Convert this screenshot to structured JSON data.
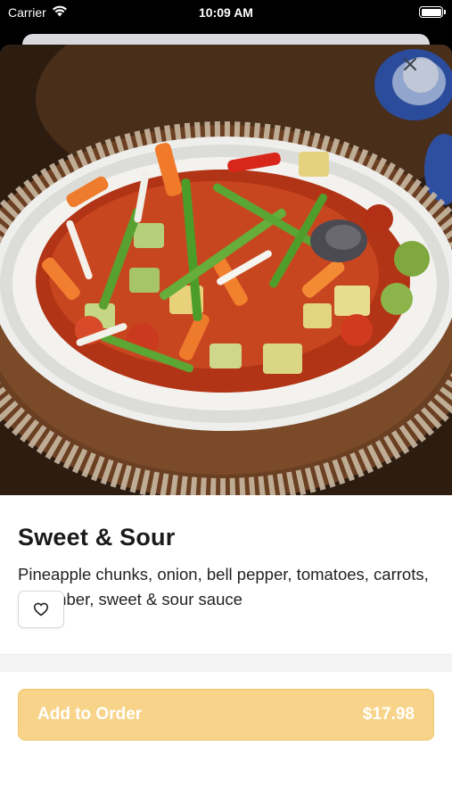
{
  "status_bar": {
    "carrier": "Carrier",
    "time": "10:09 AM"
  },
  "item": {
    "title": "Sweet & Sour",
    "description": "Pineapple chunks, onion, bell pepper, tomatoes, carrots, cucumber, sweet & sour sauce"
  },
  "actions": {
    "add_to_order_label": "Add to Order",
    "price": "$17.98"
  },
  "icons": {
    "close": "close-icon",
    "favorite": "heart-outline-icon",
    "wifi": "wifi-icon",
    "battery": "battery-icon"
  },
  "colors": {
    "accent": "#f8d48a",
    "accent_border": "#efc56a",
    "title_text": "#1a1a1a"
  }
}
